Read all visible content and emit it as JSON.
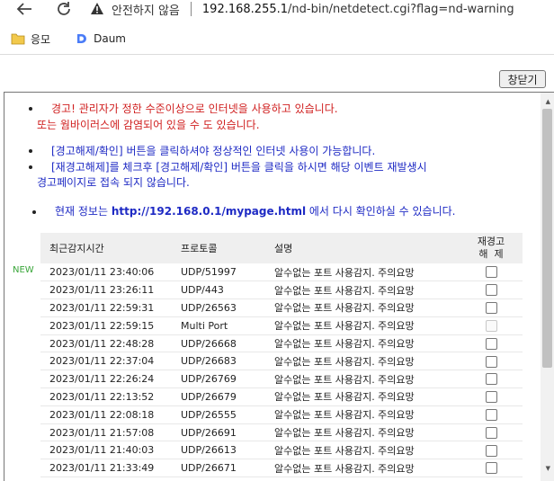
{
  "browser": {
    "insecure_label": "안전하지 않음",
    "url_host": "192.168.255.1",
    "url_path": "/nd-bin/netdetect.cgi?flag=nd-warning",
    "bookmarks": [
      {
        "label": "응모"
      },
      {
        "label": "Daum"
      }
    ]
  },
  "page": {
    "close_button": "창닫기",
    "warning_line1": "경고! 관리자가 정한 수준이상으로 인터넷을 사용하고 있습니다.",
    "warning_line2": "또는 웜바이러스에 감염되어 있을 수 도 있습니다.",
    "instr_line1": "[경고해제/확인] 버튼을 클릭하셔야 정상적인 인터넷 사용이 가능합니다.",
    "instr_line2": "[재경고해제]를 체크후 [경고해제/확인] 버튼을 클릭을 하시면 해당 이벤트 재발생시",
    "instr_line3": "경고페이지로 접속 되지 않습니다.",
    "info_prefix": "현재 정보는 ",
    "info_link": "http://192.168.0.1/mypage.html",
    "info_suffix": " 에서 다시 확인하실 수 있습니다.",
    "new_tag": "NEW",
    "table": {
      "headers": [
        "최근감지시간",
        "프로토콜",
        "설명"
      ],
      "check_header_1": "재경고",
      "check_header_2": "해  제",
      "rows": [
        {
          "time": "2023/01/11 23:40:06",
          "protocol": "UDP/51997",
          "desc": "알수없는 포트 사용감지. 주의요망",
          "disabled": false
        },
        {
          "time": "2023/01/11 23:26:11",
          "protocol": "UDP/443",
          "desc": "알수없는 포트 사용감지. 주의요망",
          "disabled": false
        },
        {
          "time": "2023/01/11 22:59:31",
          "protocol": "UDP/26563",
          "desc": "알수없는 포트 사용감지. 주의요망",
          "disabled": false
        },
        {
          "time": "2023/01/11 22:59:15",
          "protocol": "Multi Port",
          "desc": "알수없는 포트 사용감지. 주의요망",
          "disabled": true
        },
        {
          "time": "2023/01/11 22:48:28",
          "protocol": "UDP/26668",
          "desc": "알수없는 포트 사용감지. 주의요망",
          "disabled": false
        },
        {
          "time": "2023/01/11 22:37:04",
          "protocol": "UDP/26683",
          "desc": "알수없는 포트 사용감지. 주의요망",
          "disabled": false
        },
        {
          "time": "2023/01/11 22:26:24",
          "protocol": "UDP/26769",
          "desc": "알수없는 포트 사용감지. 주의요망",
          "disabled": false
        },
        {
          "time": "2023/01/11 22:13:52",
          "protocol": "UDP/26679",
          "desc": "알수없는 포트 사용감지. 주의요망",
          "disabled": false
        },
        {
          "time": "2023/01/11 22:08:18",
          "protocol": "UDP/26555",
          "desc": "알수없는 포트 사용감지. 주의요망",
          "disabled": false
        },
        {
          "time": "2023/01/11 21:57:08",
          "protocol": "UDP/26691",
          "desc": "알수없는 포트 사용감지. 주의요망",
          "disabled": false
        },
        {
          "time": "2023/01/11 21:40:03",
          "protocol": "UDP/26613",
          "desc": "알수없는 포트 사용감지. 주의요망",
          "disabled": false
        },
        {
          "time": "2023/01/11 21:33:49",
          "protocol": "UDP/26671",
          "desc": "알수없는 포트 사용감지. 주의요망",
          "disabled": false
        }
      ]
    }
  }
}
